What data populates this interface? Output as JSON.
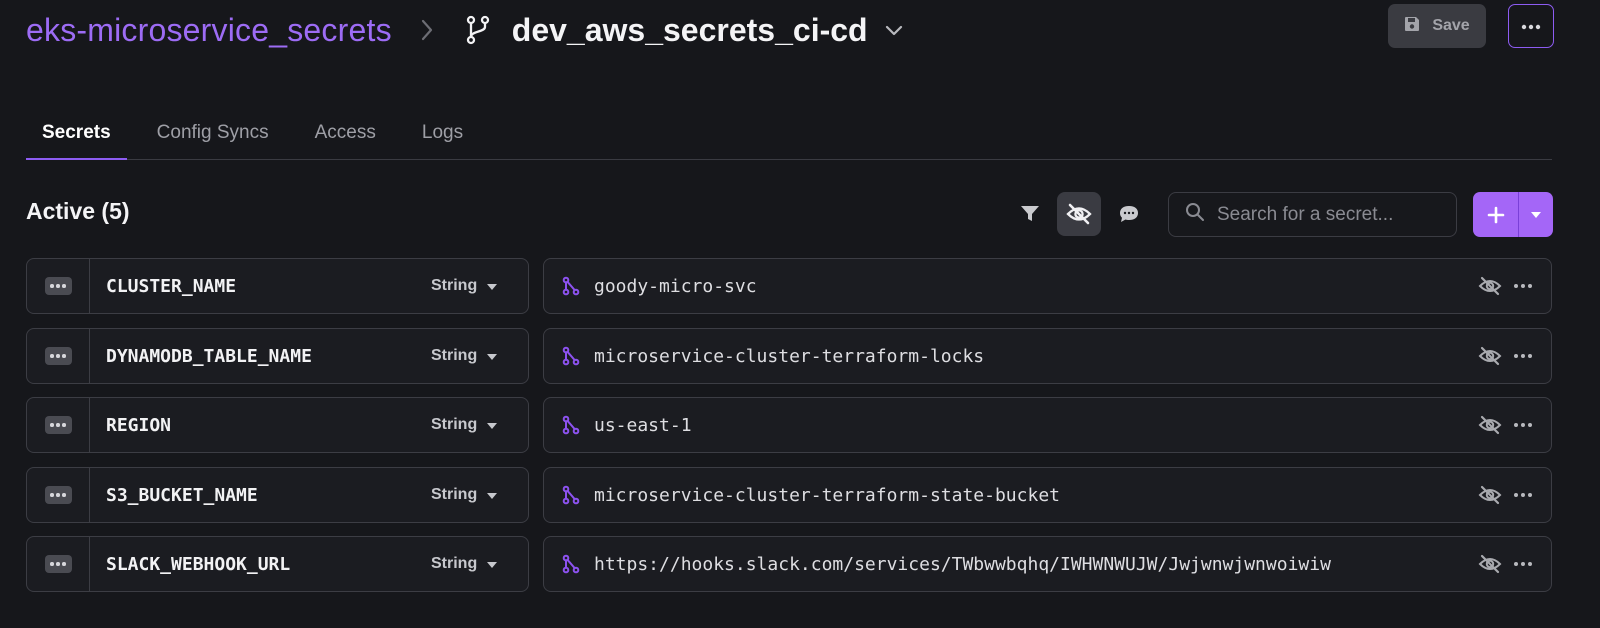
{
  "header": {
    "project_name": "eks-microservice_secrets",
    "branch_name": "dev_aws_secrets_ci-cd",
    "save_label": "Save"
  },
  "tabs": [
    {
      "label": "Secrets",
      "active": true
    },
    {
      "label": "Config Syncs",
      "active": false
    },
    {
      "label": "Access",
      "active": false
    },
    {
      "label": "Logs",
      "active": false
    }
  ],
  "toolbar": {
    "section_title": "Active (5)",
    "search_placeholder": "Search for a secret...",
    "icons": [
      "filter-icon",
      "eye-off-icon",
      "comment-icon"
    ]
  },
  "secrets": [
    {
      "name": "CLUSTER_NAME",
      "type": "String",
      "value": "goody-micro-svc"
    },
    {
      "name": "DYNAMODB_TABLE_NAME",
      "type": "String",
      "value": "microservice-cluster-terraform-locks"
    },
    {
      "name": "REGION",
      "type": "String",
      "value": "us-east-1"
    },
    {
      "name": "S3_BUCKET_NAME",
      "type": "String",
      "value": "microservice-cluster-terraform-state-bucket"
    },
    {
      "name": "SLACK_WEBHOOK_URL",
      "type": "String",
      "value": "https://hooks.slack.com/services/TWbwwbqhq/IWHWNWUJW/Jwjwnwjwnwoiwiw"
    }
  ],
  "colors": {
    "accent": "#9d6cf5",
    "background": "#16171b",
    "add_button": "#a466f7"
  }
}
